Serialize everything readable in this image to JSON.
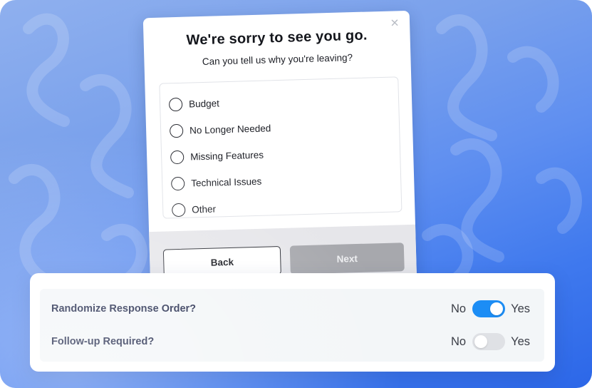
{
  "dialog": {
    "title": "We're sorry to see you go.",
    "subtitle": "Can you tell us why you're leaving?",
    "close_icon": "close-icon",
    "options": [
      {
        "label": "Budget",
        "selected": false
      },
      {
        "label": "No Longer Needed",
        "selected": false
      },
      {
        "label": "Missing Features",
        "selected": false
      },
      {
        "label": "Technical Issues",
        "selected": false
      },
      {
        "label": "Other",
        "selected": false
      }
    ],
    "back_label": "Back",
    "next_label": "Next"
  },
  "settings": {
    "randomize": {
      "label": "Randomize Response Order?",
      "no_label": "No",
      "yes_label": "Yes",
      "enabled": true
    },
    "followup": {
      "label": "Follow-up Required?",
      "no_label": "No",
      "yes_label": "Yes",
      "enabled": false
    }
  },
  "colors": {
    "toggle_on": "#1c8df5",
    "toggle_off": "#dfe1e5",
    "next_disabled": "#a7a8ad",
    "background_gradient_end": "#2c67e8"
  }
}
